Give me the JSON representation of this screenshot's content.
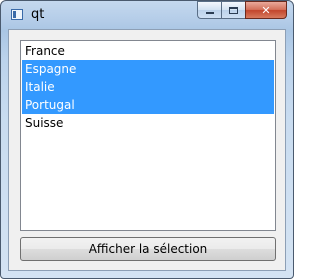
{
  "window": {
    "title": "qt",
    "controls": {
      "close_glyph": "✕"
    }
  },
  "list": {
    "items": [
      {
        "label": "France",
        "selected": false
      },
      {
        "label": "Espagne",
        "selected": true
      },
      {
        "label": "Italie",
        "selected": true
      },
      {
        "label": "Portugal",
        "selected": true
      },
      {
        "label": "Suisse",
        "selected": false
      }
    ],
    "selection_color": "#3399ff"
  },
  "action": {
    "button_label": "Afficher la sélection"
  }
}
